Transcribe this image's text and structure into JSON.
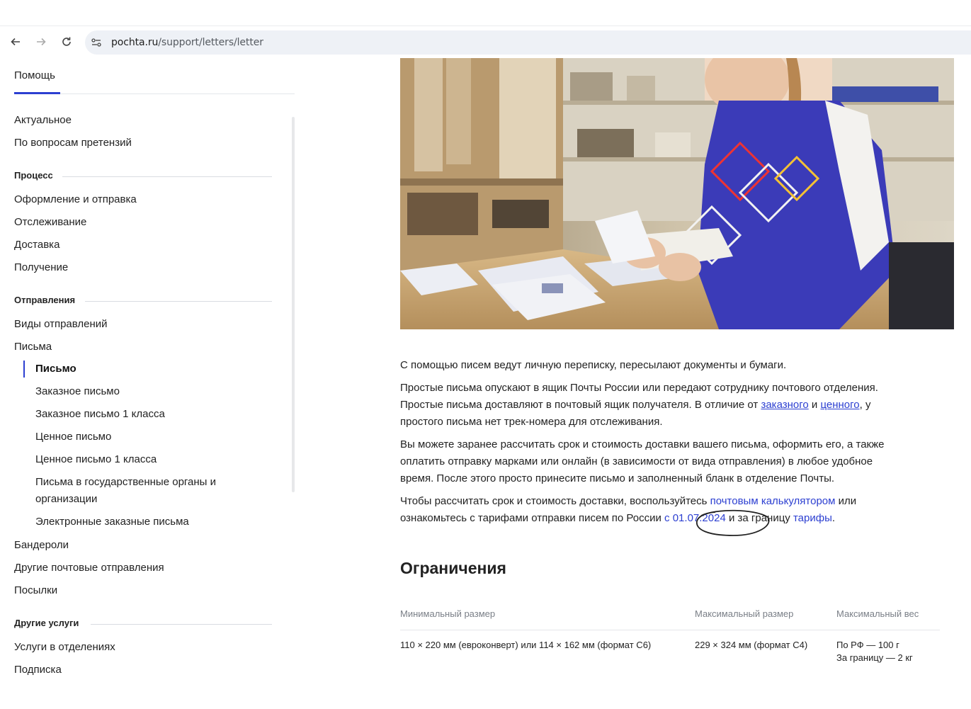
{
  "browser": {
    "url_host": "pochta.ru",
    "url_path": "/support/letters/letter"
  },
  "sidebar": {
    "tab": "Помощь",
    "top_items": [
      "Актуальное",
      "По вопросам претензий"
    ],
    "sections": [
      {
        "title": "Процесс",
        "items": [
          "Оформление и отправка",
          "Отслеживание",
          "Доставка",
          "Получение"
        ]
      },
      {
        "title": "Отправления",
        "items": [
          "Виды отправлений",
          "Письма"
        ]
      }
    ],
    "letters_subitems": [
      "Письмо",
      "Заказное письмо",
      "Заказное письмо 1 класса",
      "Ценное письмо",
      "Ценное письмо 1 класса",
      "Письма в государственные органы и",
      "организации",
      "Электронные заказные письма"
    ],
    "after_letters": [
      "Бандероли",
      "Другие почтовые отправления",
      "Посылки"
    ],
    "other_section": {
      "title": "Другие услуги",
      "items": [
        "Услуги в отделениях",
        "Подписка"
      ]
    }
  },
  "content": {
    "p1": "С помощью писем ведут личную переписку, пересылают документы и бумаги.",
    "p2_line1": "Простые письма опускают в ящик Почты России или передают сотруднику почтового отделения.",
    "p2_line2_a": "Простые письма доставляют в почтовый ящик получателя. В отличие от ",
    "p2_link1": "заказного",
    "p2_and": " и ",
    "p2_link2": "ценного",
    "p2_line2_b": ", у",
    "p2_line3": "простого письма нет трек-номера для отслеживания.",
    "p3_line1": "Вы можете заранее рассчитать срок и стоимость доставки вашего письма, оформить его, а также",
    "p3_line2": "оплатить отправку марками или онлайн (в зависимости от вида отправления) в любое удобное",
    "p3_line3": "время. После этого просто принесите письмо и заполненный бланк в отделение Почты.",
    "p4_line1_a": "Чтобы рассчитать срок и стоимость доставки, воспользуйтесь ",
    "p4_link_calc": "почтовым калькулятором",
    "p4_line1_b": " или",
    "p4_line2_a": "ознакомьтесь с тарифами отправки писем по России ",
    "p4_link_date": "с 01.07.2024",
    "p4_line2_b": " и за границу ",
    "p4_link_tariffs": "тарифы",
    "p4_end": ".",
    "limits_title": "Ограничения",
    "table": {
      "headers": [
        "Минимальный размер",
        "Максимальный размер",
        "Максимальный вес"
      ],
      "row": {
        "min": "110 × 220 мм (евроконверт) или 114 × 162 мм (формат C6)",
        "max": "229 × 324 мм (формат C4)",
        "weight_rf": "По РФ — 100 г",
        "weight_abroad": "За границу — 2 кг"
      }
    }
  },
  "colors": {
    "accent": "#2c3fd1",
    "vest": "#3b3bb8"
  }
}
